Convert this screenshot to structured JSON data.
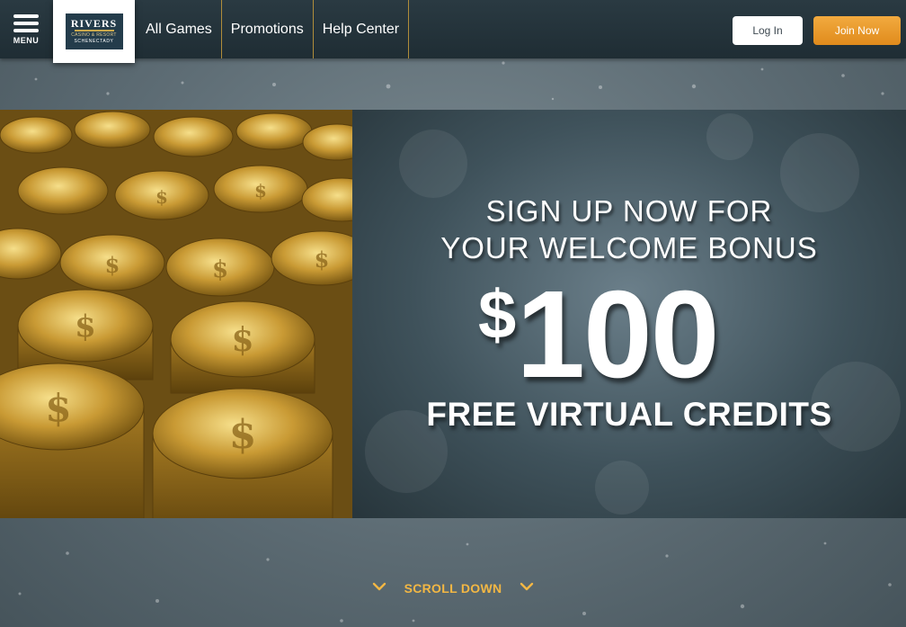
{
  "menu": {
    "label": "MENU",
    "icon": "hamburger-menu-icon"
  },
  "logo": {
    "line1": "RIVERS",
    "line2": "CASINO & RESORT",
    "line3": "SCHENECTADY"
  },
  "nav": {
    "items": [
      {
        "label": "All Games"
      },
      {
        "label": "Promotions"
      },
      {
        "label": "Help Center"
      }
    ]
  },
  "auth": {
    "login_label": "Log In",
    "join_label": "Join Now"
  },
  "banner": {
    "line1": "SIGN UP NOW FOR",
    "line2": "YOUR WELCOME BONUS",
    "currency": "$",
    "amount": "100",
    "line3": "FREE VIRTUAL CREDITS"
  },
  "scroll": {
    "label": "SCROLL DOWN",
    "icon": "chevron-down-icon"
  },
  "colors": {
    "accent_orange": "#e98f1e",
    "accent_gold": "#f2b744",
    "topbar": "#24343b",
    "background": "#6a7a82"
  }
}
